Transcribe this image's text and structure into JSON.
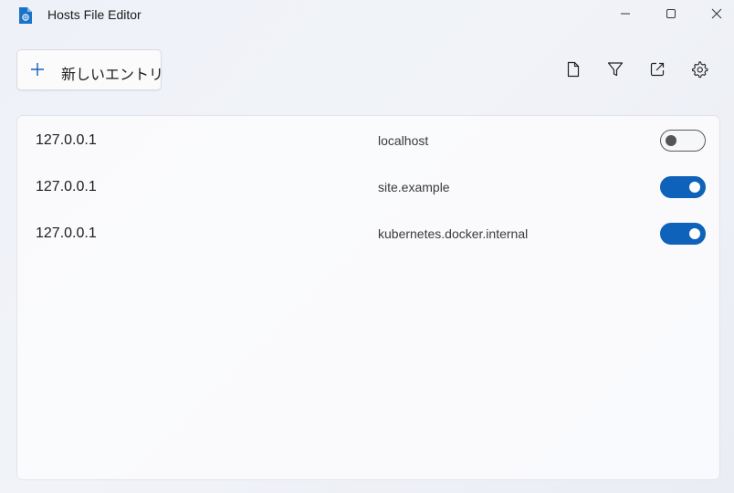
{
  "window": {
    "title": "Hosts File Editor",
    "controls": [
      "minimize",
      "maximize",
      "close"
    ]
  },
  "toolbar": {
    "new_entry_label": "新しいエントリ",
    "icons": [
      "file-icon",
      "filter-icon",
      "open-external-icon",
      "settings-icon"
    ]
  },
  "entries": [
    {
      "address": "127.0.0.1",
      "hosts": "localhost",
      "active": false
    },
    {
      "address": "127.0.0.1",
      "hosts": "site.example",
      "active": true
    },
    {
      "address": "127.0.0.1",
      "hosts": "kubernetes.docker.internal",
      "active": true
    }
  ],
  "colors": {
    "accent": "#0f62b9",
    "app_icon": "#1a73c8"
  }
}
